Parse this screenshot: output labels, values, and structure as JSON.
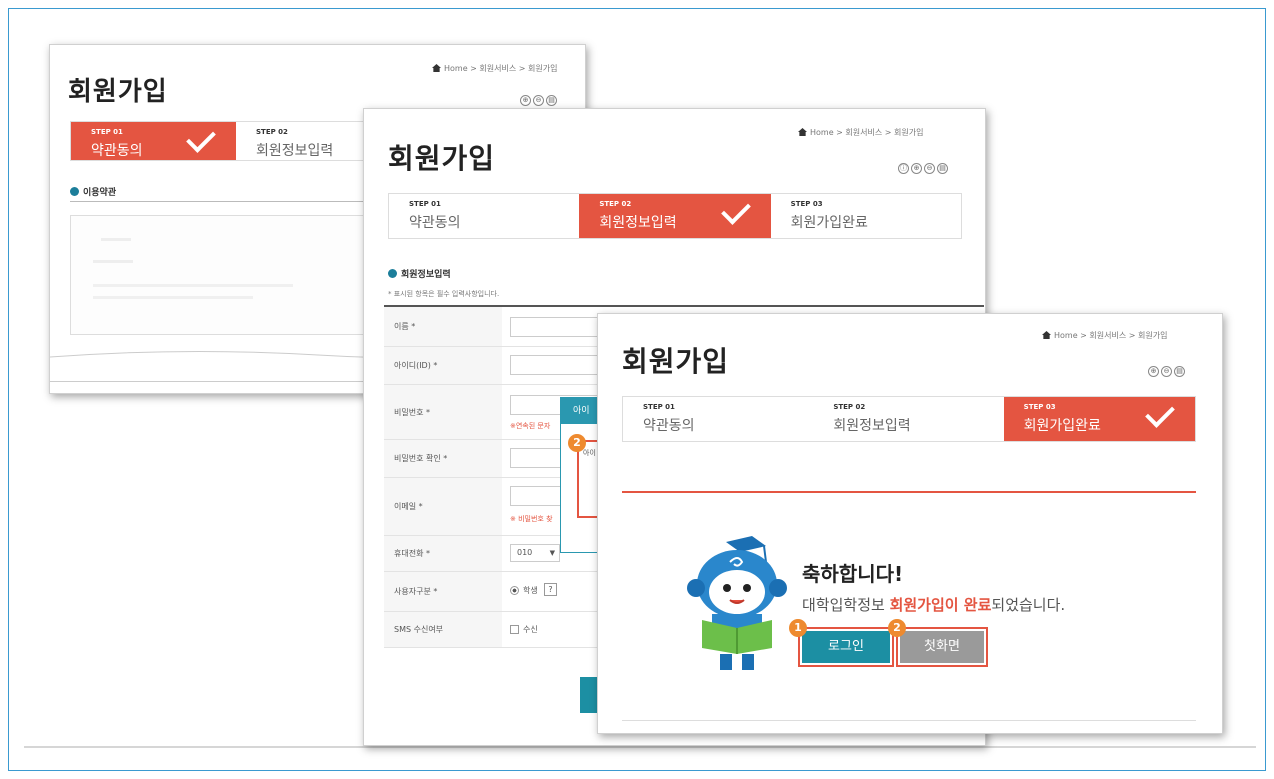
{
  "shot1": {
    "title": "회원가입",
    "breadcrumb": "Home > 회원서비스 > 회원가입",
    "tools": [
      "⊕",
      "⊖",
      "▤"
    ],
    "steps": [
      {
        "num": "STEP 01",
        "label": "약관동의"
      },
      {
        "num": "STEP 02",
        "label": "회원정보입력"
      }
    ],
    "section": "이용약관"
  },
  "shot2": {
    "title": "회원가입",
    "breadcrumb": "Home > 회원서비스 > 회원가입",
    "tools": [
      "ⓘ",
      "⊕",
      "⊖",
      "▤"
    ],
    "steps": [
      {
        "num": "STEP 01",
        "label": "약관동의"
      },
      {
        "num": "STEP 02",
        "label": "회원정보입력"
      },
      {
        "num": "STEP 03",
        "label": "회원가입완료"
      }
    ],
    "section": "회원정보입력",
    "note": "* 표시된 항목은 필수 입력사항입니다.",
    "rows": [
      {
        "label": "이름 *"
      },
      {
        "label": "아이디(ID) *"
      },
      {
        "label": "비밀번호 *",
        "hint": "※연속된 문자"
      },
      {
        "label": "비밀번호 확인 *"
      },
      {
        "label": "이메일 *",
        "hint": "※ 비밀번호 찾"
      },
      {
        "label": "휴대전화 *",
        "value": "010"
      },
      {
        "label": "사용자구분 *",
        "value": "학생",
        "help": "?"
      },
      {
        "label": "SMS 수신여부",
        "value": "수신"
      }
    ],
    "popup_title": "아이",
    "popup_text": "아이",
    "badge": "2"
  },
  "shot3": {
    "title": "회원가입",
    "breadcrumb": "Home > 회원서비스 > 회원가입",
    "tools": [
      "⊕",
      "⊖",
      "▤"
    ],
    "steps": [
      {
        "num": "STEP 01",
        "label": "약관동의"
      },
      {
        "num": "STEP 02",
        "label": "회원정보입력"
      },
      {
        "num": "STEP 03",
        "label": "회원가입완료"
      }
    ],
    "congrats": "축하합니다!",
    "message_pre": "대학입학정보 ",
    "message_em": "회원가입이 완료",
    "message_post": "되었습니다.",
    "login_label": "로그인",
    "home_label": "첫화면",
    "badge1": "1",
    "badge2": "2"
  },
  "colors": {
    "accent": "#e45541",
    "teal": "#1c8fa3",
    "badge": "#ee8a2f"
  }
}
